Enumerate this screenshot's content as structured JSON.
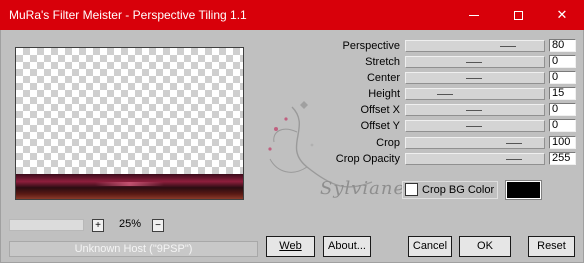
{
  "window": {
    "title": "MuRa's Filter Meister - Perspective Tiling 1.1",
    "accent_color": "#d8000a"
  },
  "preview": {
    "zoom_level": "25%",
    "zoom_in_label": "+",
    "zoom_out_label": "−"
  },
  "status": {
    "text": "Unknown Host (\"9PSP\")"
  },
  "params": [
    {
      "label": "Perspective",
      "value": "80"
    },
    {
      "label": "Stretch",
      "value": "0"
    },
    {
      "label": "Center",
      "value": "0"
    },
    {
      "label": "Height",
      "value": "15"
    },
    {
      "label": "Offset X",
      "value": "0"
    },
    {
      "label": "Offset Y",
      "value": "0"
    },
    {
      "label": "Crop",
      "value": "100"
    },
    {
      "label": "Crop Opacity",
      "value": "255"
    }
  ],
  "crop_bg": {
    "label": "Crop BG Color",
    "checked": false,
    "color": "#000000"
  },
  "buttons": {
    "web": "Web",
    "about": "About...",
    "cancel": "Cancel",
    "ok": "OK",
    "reset": "Reset"
  },
  "watermark": {
    "text": "Sylviane"
  }
}
